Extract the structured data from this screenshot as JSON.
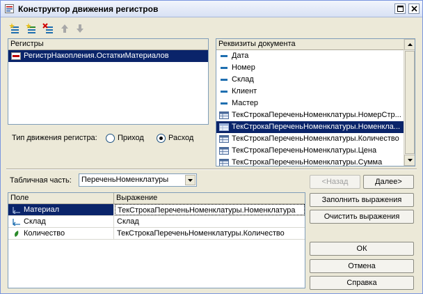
{
  "window": {
    "title": "Конструктор движения регистров"
  },
  "toolbar": {
    "buttons": [
      "add-register-icon",
      "add-child-icon",
      "delete-icon",
      "move-up-icon",
      "move-down-icon"
    ]
  },
  "registers": {
    "header": "Регистры",
    "items": [
      {
        "label": "РегистрНакопления.ОстаткиМатериалов",
        "icon": "accumulation-register-icon",
        "selected": true
      }
    ]
  },
  "attributes": {
    "header": "Реквизиты документа",
    "items": [
      {
        "label": "Дата",
        "icon": "attribute-icon"
      },
      {
        "label": "Номер",
        "icon": "attribute-icon"
      },
      {
        "label": "Склад",
        "icon": "attribute-icon"
      },
      {
        "label": "Клиент",
        "icon": "attribute-icon"
      },
      {
        "label": "Мастер",
        "icon": "attribute-icon"
      },
      {
        "label": "ТекСтрокаПереченьНоменклатуры.НомерСтр...",
        "icon": "table-attribute-icon"
      },
      {
        "label": "ТекСтрокаПереченьНоменклатуры.Номенкла...",
        "icon": "table-attribute-icon",
        "selected": true
      },
      {
        "label": "ТекСтрокаПереченьНоменклатуры.Количество",
        "icon": "table-attribute-icon"
      },
      {
        "label": "ТекСтрокаПереченьНоменклатуры.Цена",
        "icon": "table-attribute-icon"
      },
      {
        "label": "ТекСтрокаПереченьНоменклатуры.Сумма",
        "icon": "table-attribute-icon"
      }
    ]
  },
  "movement": {
    "label": "Тип движения регистра:",
    "options": [
      "Приход",
      "Расход"
    ],
    "selected": "Расход"
  },
  "tabular": {
    "label": "Табличная часть:",
    "value": "ПереченьНоменклатуры"
  },
  "nav": {
    "back": "<Назад",
    "next": "Далее>"
  },
  "grid": {
    "columns": [
      "Поле",
      "Выражение"
    ],
    "rows": [
      {
        "field": "Материал",
        "expression": "ТекСтрокаПереченьНоменклатуры.Номенклатура",
        "icon": "dimension-icon",
        "selected": true
      },
      {
        "field": "Склад",
        "expression": "Склад",
        "icon": "dimension-icon"
      },
      {
        "field": "Количество",
        "expression": "ТекСтрокаПереченьНоменклатуры.Количество",
        "icon": "resource-icon"
      }
    ]
  },
  "actions": {
    "fill": "Заполнить выражения",
    "clear": "Очистить выражения",
    "ok": "ОК",
    "cancel": "Отмена",
    "help": "Справка"
  },
  "colors": {
    "selection": "#0a246a",
    "accent_red": "#c00000",
    "accent_green": "#2a8a2a",
    "attribute_blue": "#1f6fb0"
  }
}
